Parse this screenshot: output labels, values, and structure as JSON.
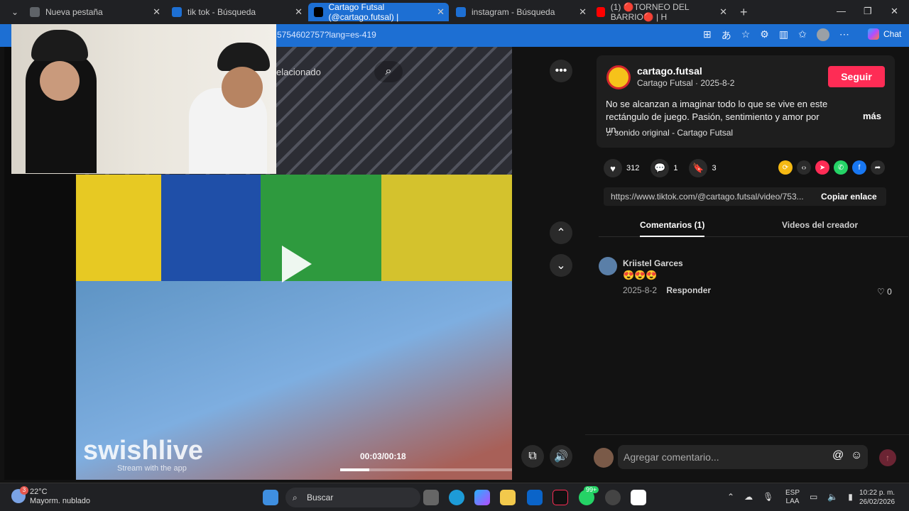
{
  "browser": {
    "tabs": [
      {
        "title": "Nueva pestaña",
        "fav_color": "#5f6368"
      },
      {
        "title": "tik tok - Búsqueda",
        "fav_color": "#1d6fd3"
      },
      {
        "title": "Cartago Futsal (@cartago.futsal) |",
        "fav_color": "#000000"
      },
      {
        "title": "instagram - Búsqueda",
        "fav_color": "#1d6fd3"
      },
      {
        "title": "(1) 🔴TORNEO DEL BARRIO🔴 | H",
        "fav_color": "#ff0000"
      }
    ],
    "new_tab": "+",
    "url": "5754602757?lang=es-419",
    "chat_label": "Chat"
  },
  "video": {
    "search_overlay": "elacionado",
    "watermark": "swishlive",
    "watermark_sub": "Stream with the app",
    "time": "00:03/00:18",
    "progress": 0.17
  },
  "post": {
    "username": "cartago.futsal",
    "subline": "Cartago Futsal · 2025-8-2",
    "follow_label": "Seguir",
    "description": "No se alcanzan a imaginar todo lo que se vive en este rectángulo de juego. Pasión, sentimiento y amor por un...",
    "more_label": "más",
    "sound": "sonido original - Cartago Futsal",
    "likes": "312",
    "comments": "1",
    "saves": "3",
    "link": "https://www.tiktok.com/@cartago.futsal/video/753...",
    "copy_label": "Copiar enlace",
    "tab_comments": "Comentarios (1)",
    "tab_creator": "Videos del creador"
  },
  "comment": {
    "author": "Kriistel Garces",
    "emojis": "😍😍😍",
    "date": "2025-8-2",
    "reply_label": "Responder",
    "likes": "0"
  },
  "input": {
    "placeholder": "Agregar comentario...",
    "at": "@"
  },
  "taskbar": {
    "temp": "22°C",
    "weather": "Mayorm. nublado",
    "weather_badge": "3",
    "search": "Buscar",
    "lang1": "ESP",
    "lang2": "LAA",
    "time": "10:22 p. m.",
    "date": "26/02/2026",
    "badge": "99+"
  },
  "colors": {
    "accent": "#fe2c55",
    "browser_blue": "#1d6fd3"
  }
}
